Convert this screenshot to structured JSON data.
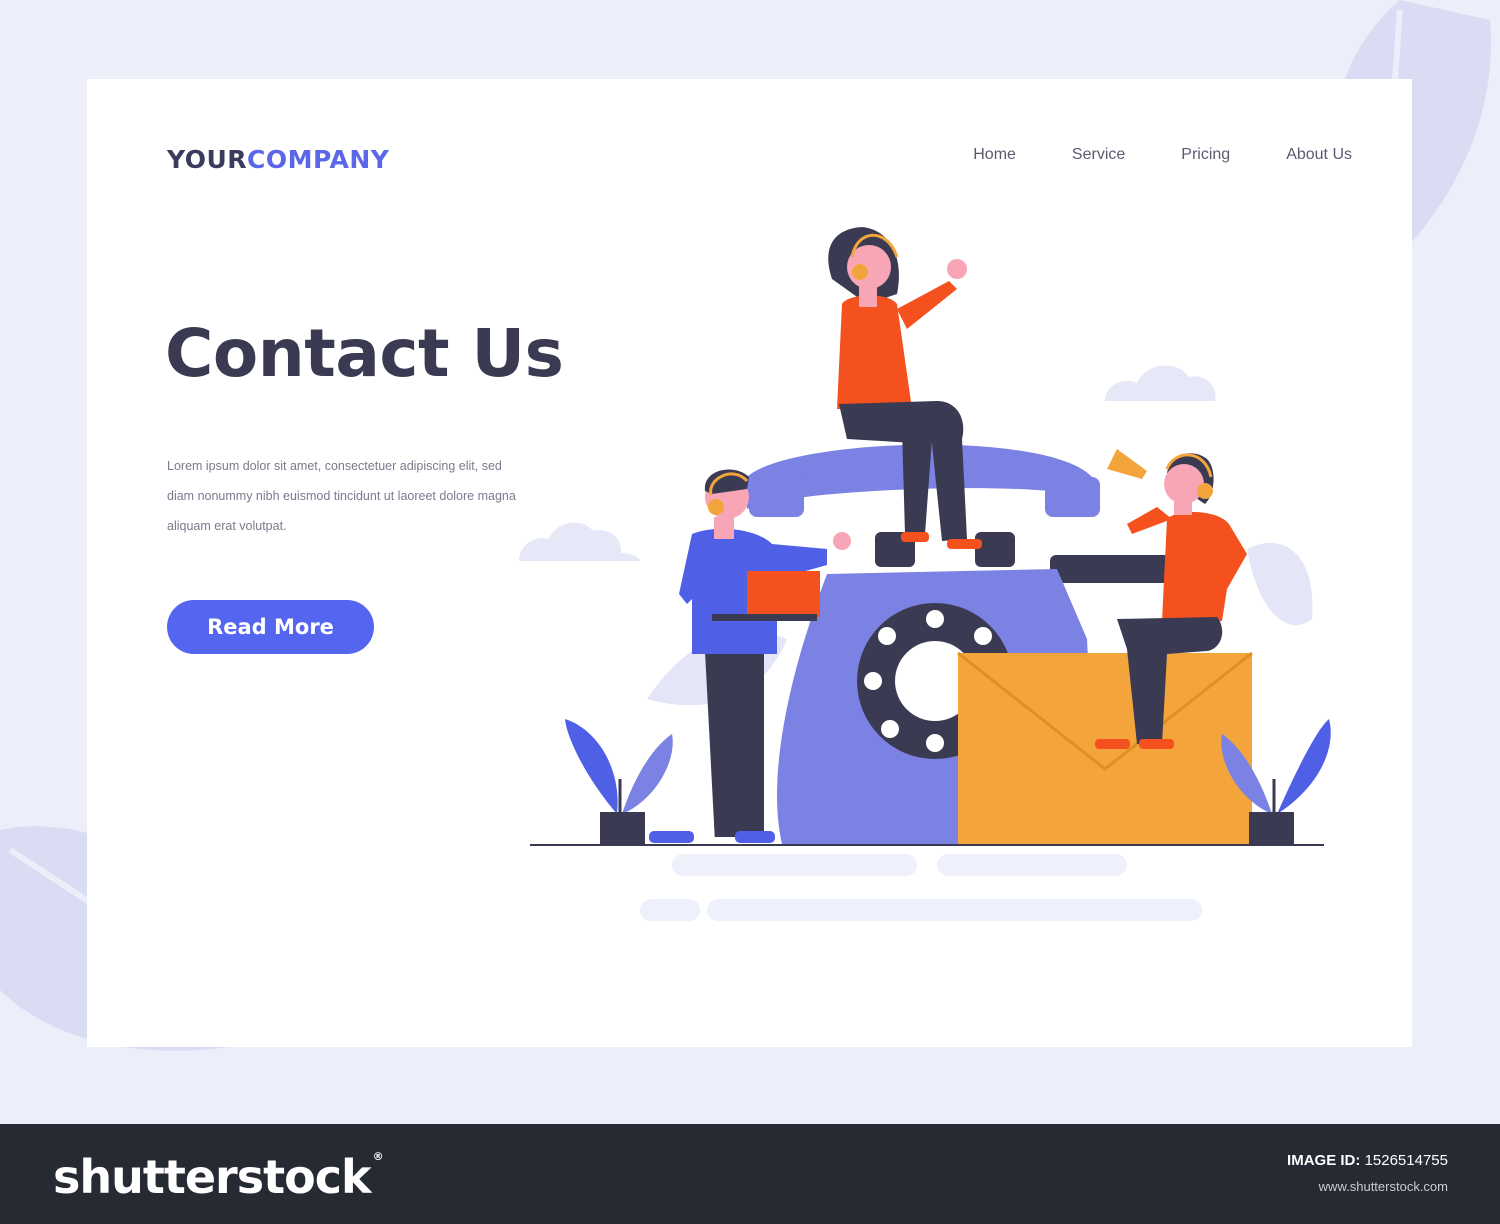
{
  "logo": {
    "part1": "YOUR",
    "part2": "COMPANY"
  },
  "nav": [
    {
      "label": "Home"
    },
    {
      "label": "Service"
    },
    {
      "label": "Pricing"
    },
    {
      "label": "About Us"
    }
  ],
  "hero": {
    "title": "Contact Us",
    "body": "Lorem ipsum dolor sit amet, consectetuer adipiscing elit, sed diam nonummy nibh euismod tincidunt ut laoreet dolore magna aliquam erat volutpat.",
    "button_label": "Read More"
  },
  "footer": {
    "brand": "shutterstock",
    "brand_mark": "®",
    "image_id_label": "IMAGE ID:",
    "image_id_value": "1526514755",
    "site": "www.shutterstock.com"
  },
  "colors": {
    "accent": "#5465f0",
    "dark": "#3a3b52",
    "phone": "#7b82e3",
    "shirt": "#f4511e",
    "envelope": "#f3a53c",
    "footer_bg": "#262a33"
  },
  "icons": [
    "headset-icon",
    "laptop-icon",
    "megaphone-icon",
    "envelope-icon",
    "rotary-phone-icon",
    "plant-icon",
    "cloud-icon",
    "leaf-icon"
  ]
}
